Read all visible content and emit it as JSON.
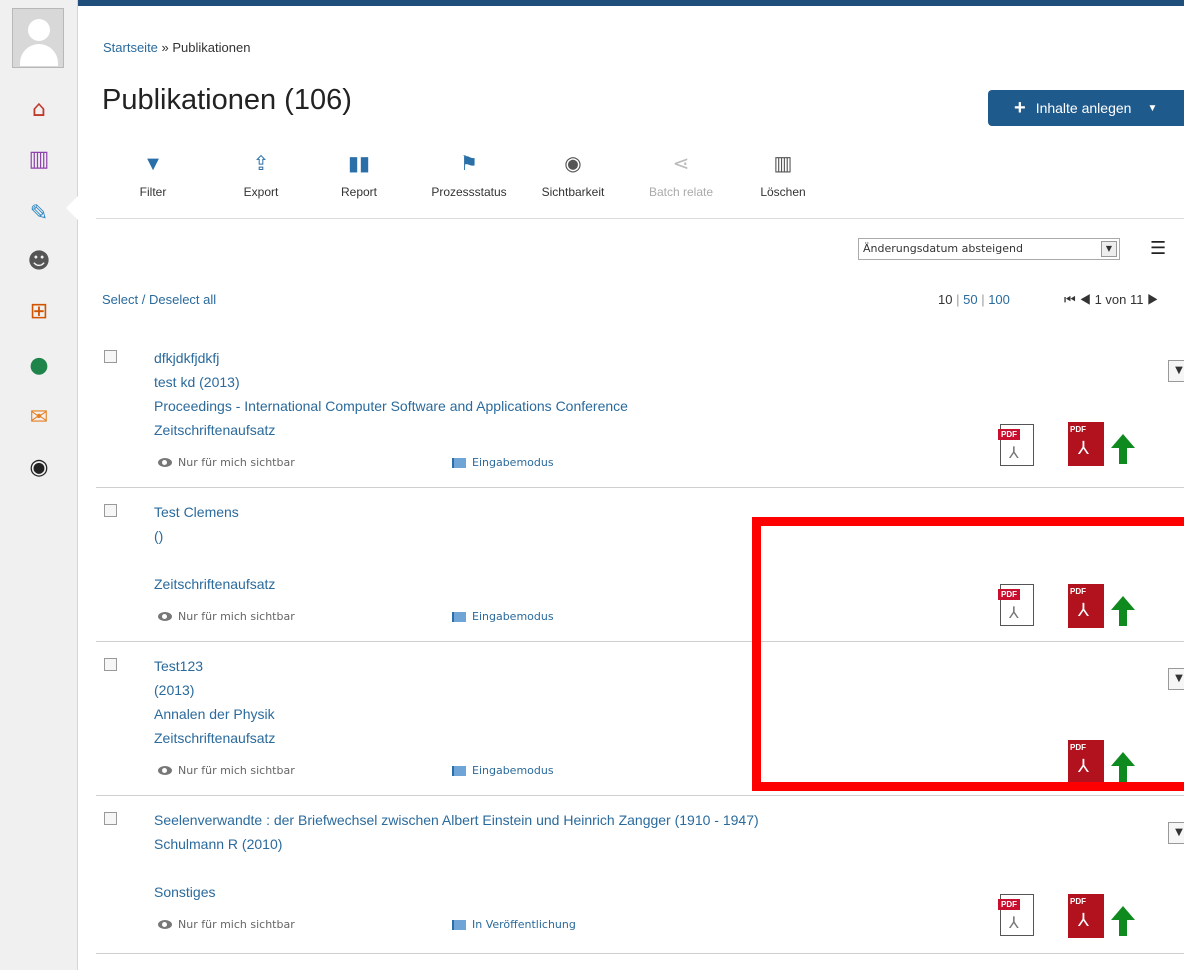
{
  "breadcrumb": {
    "home": "Startseite",
    "sep": " » ",
    "current": "Publikationen"
  },
  "page": {
    "title": "Publikationen (106)"
  },
  "add_button": {
    "label": "Inhalte anlegen"
  },
  "toolbar": {
    "filter": "Filter",
    "export": "Export",
    "report": "Report",
    "process_status": "Prozessstatus",
    "visibility": "Sichtbarkeit",
    "batch_relate": "Batch relate",
    "delete": "Löschen"
  },
  "sort": {
    "selected": "Änderungsdatum absteigend"
  },
  "list_controls": {
    "select_all": "Select / Deselect all",
    "per_page": [
      "10",
      "50",
      "100"
    ],
    "pager_text": "1 von 11"
  },
  "items": [
    {
      "title": "dfkjdkfjdkfj",
      "author_year": "test kd (2013)",
      "venue": "Proceedings - International Computer Software and Applications Conference",
      "type": "Zeitschriftenaufsatz",
      "visibility": "Nur für mich sichtbar",
      "status": "Eingabemodus"
    },
    {
      "title": "Test Clemens",
      "author_year": "()",
      "venue": "",
      "type": "Zeitschriftenaufsatz",
      "visibility": "Nur für mich sichtbar",
      "status": "Eingabemodus"
    },
    {
      "title": "Test123",
      "author_year": "(2013)",
      "venue": "Annalen der Physik",
      "type": "Zeitschriftenaufsatz",
      "visibility": "Nur für mich sichtbar",
      "status": "Eingabemodus"
    },
    {
      "title": "Seelenverwandte : der Briefwechsel zwischen Albert Einstein und Heinrich Zangger (1910 - 1947)",
      "author_year": "Schulmann R (2010)",
      "venue": "",
      "type": "Sonstiges",
      "visibility": "Nur für mich sichtbar",
      "status": "In Veröffentlichung"
    }
  ],
  "icons": {
    "pdf_tag": "PDF",
    "colors": {
      "link": "#2a6a9c",
      "primary_button": "#1f5a8c",
      "pdf_red": "#b1121e",
      "upload_green": "#0f8a1e",
      "highlight": "#ff0000"
    }
  }
}
